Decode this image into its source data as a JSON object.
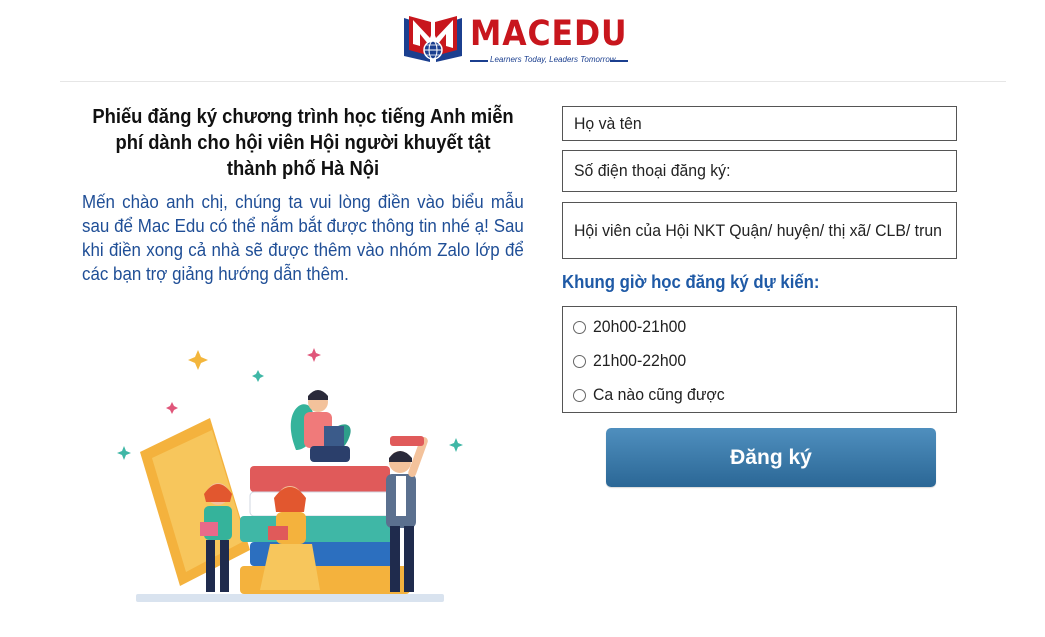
{
  "brand": {
    "name": "MACEDU",
    "tagline": "Learners Today, Leaders Tomorrow",
    "logo_icon": "book-globe-logo-icon",
    "colors": {
      "red": "#c8161d",
      "blue": "#1b3f8f"
    }
  },
  "left": {
    "title": "Phiếu đăng ký chương trình học tiếng Anh miễn phí dành cho hội viên Hội người khuyết tật thành phố Hà Nội",
    "intro": "Mến chào anh chị, chúng ta vui lòng điền vào biểu mẫu sau để Mac Edu có thể nắm bắt được thông tin nhé ạ! Sau khi điền xong cả nhà sẽ được thêm vào nhóm Zalo lớp để các bạn trợ giảng hướng dẫn thêm.",
    "illustration": "students-reading-books-illustration"
  },
  "form": {
    "name_placeholder": "Họ và tên",
    "phone_placeholder": "Số điện thoại đăng ký:",
    "member_placeholder": "Hội viên của Hội NKT Quận/ huyện/ thị xã/ CLB/ trun",
    "schedule_label": "Khung giờ học đăng ký dự kiến:",
    "schedule_options": [
      "20h00-21h00",
      "21h00-22h00",
      "Ca nào cũng được"
    ],
    "submit_label": "Đăng ký",
    "colors": {
      "label": "#1f5aa6",
      "button": "#3a7aab"
    }
  }
}
